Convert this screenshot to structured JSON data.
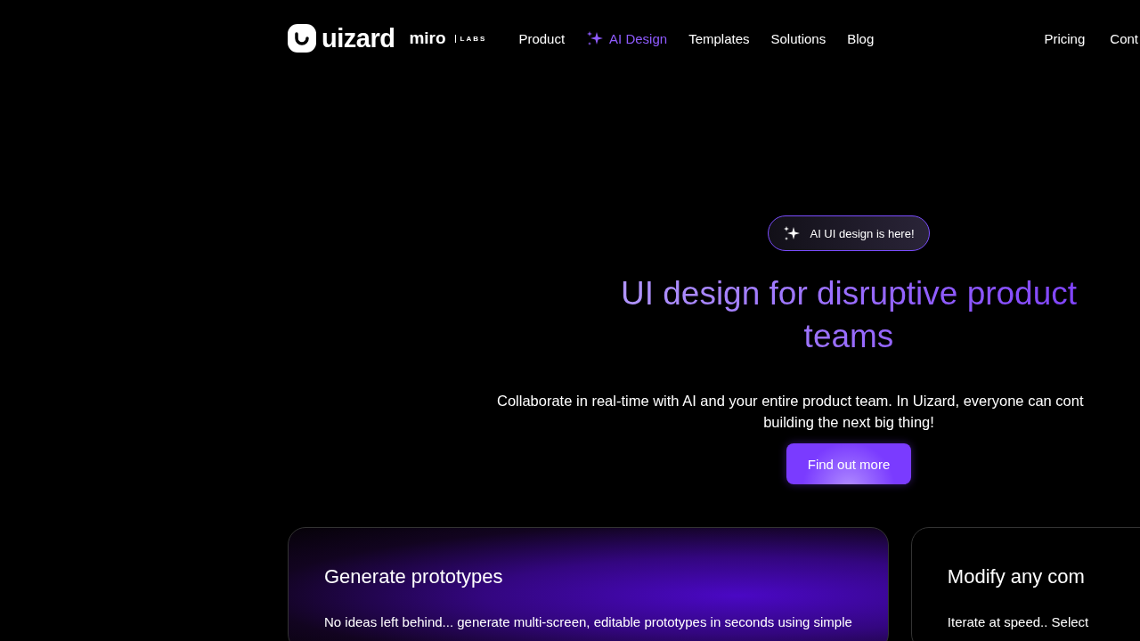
{
  "brand": {
    "name": "uizard",
    "partner": "miro",
    "partner_tag": "LABS"
  },
  "nav": [
    {
      "label": "Product",
      "selected": false,
      "kind": "plain"
    },
    {
      "label": "AI Design",
      "selected": true,
      "kind": "sparkle"
    },
    {
      "label": "Templates",
      "selected": false,
      "kind": "plain"
    },
    {
      "label": "Solutions",
      "selected": false,
      "kind": "plain"
    },
    {
      "label": "Blog",
      "selected": false,
      "kind": "plain"
    }
  ],
  "nav_right": [
    "Pricing",
    "Cont"
  ],
  "hero": {
    "badge": "AI UI design is here!",
    "title_lines": [
      "UI design for disruptive product",
      "teams"
    ],
    "subtitle_lines": [
      "Collaborate in real-time with AI and your entire product team. In Uizard, everyone can cont",
      "building the next big thing!"
    ],
    "button": "Find out more"
  },
  "cards": [
    {
      "title": "Generate prototypes",
      "text": "No ideas left behind... generate multi-screen, editable prototypes in seconds using simple",
      "glow": true
    },
    {
      "title": "Modify any com",
      "text": "Iterate at speed.. Select",
      "glow": false
    }
  ]
}
